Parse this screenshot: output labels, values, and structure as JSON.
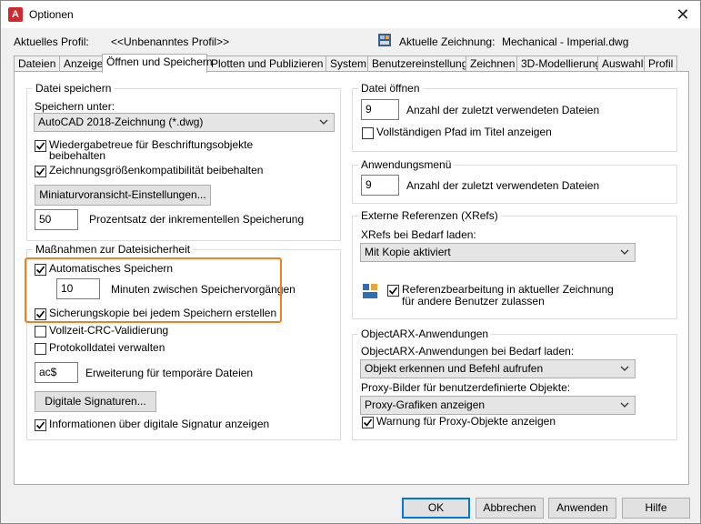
{
  "window": {
    "title": "Optionen",
    "app_icon_letter": "A"
  },
  "profile": {
    "label": "Aktuelles Profil:",
    "value": "<<Unbenanntes Profil>>",
    "drawing_label": "Aktuelle Zeichnung:",
    "drawing_value": "Mechanical - Imperial.dwg"
  },
  "tabs": [
    "Dateien",
    "Anzeige",
    "Öffnen und Speichern",
    "Plotten und Publizieren",
    "System",
    "Benutzereinstellungen",
    "Zeichnen",
    "3D-Modellierung",
    "Auswahl",
    "Profil"
  ],
  "active_tab": "Öffnen und Speichern",
  "save": {
    "title": "Datei speichern",
    "save_as_label": "Speichern unter:",
    "save_as_value": "AutoCAD 2018-Zeichnung (*.dwg)",
    "fidelity_line1": "Wiedergabetreue für Beschriftungsobjekte",
    "fidelity_line2": "beibehalten",
    "fidelity_checked": true,
    "size_compat": "Zeichnungsgrößenkompatibilität beibehalten",
    "size_compat_checked": true,
    "thumbnail_button": "Miniaturvoransicht-Einstellungen...",
    "incremental_value": "50",
    "incremental_label": "Prozentsatz der inkrementellen Speicherung"
  },
  "safety": {
    "title": "Maßnahmen zur Dateisicherheit",
    "autosave": "Automatisches Speichern",
    "autosave_checked": true,
    "minutes_value": "10",
    "minutes_label": "Minuten zwischen Speichervorgängen",
    "backup": "Sicherungskopie bei jedem Speichern erstellen",
    "backup_checked": true,
    "crc": "Vollzeit-CRC-Validierung",
    "crc_checked": false,
    "logfile": "Protokolldatei verwalten",
    "logfile_checked": false,
    "temp_ext_value": "ac$",
    "temp_ext_label": "Erweiterung für temporäre Dateien",
    "signatures_button": "Digitale Signaturen...",
    "sig_info": "Informationen über digitale Signatur anzeigen",
    "sig_info_checked": true
  },
  "open": {
    "title": "Datei öffnen",
    "recent_value": "9",
    "recent_label": "Anzahl der zuletzt verwendeten Dateien",
    "full_path": "Vollständigen Pfad im Titel anzeigen",
    "full_path_checked": false
  },
  "appmenu": {
    "title": "Anwendungsmenü",
    "recent_value": "9",
    "recent_label": "Anzahl der zuletzt verwendeten Dateien"
  },
  "xrefs": {
    "title": "Externe Referenzen (XRefs)",
    "demand_label": "XRefs bei Bedarf laden:",
    "demand_value": "Mit Kopie aktiviert",
    "edit_line1": "Referenzbearbeitung in aktueller Zeichnung",
    "edit_line2": "für andere Benutzer zulassen",
    "edit_checked": true
  },
  "arx": {
    "title": "ObjectARX-Anwendungen",
    "demand_label": "ObjectARX-Anwendungen bei Bedarf laden:",
    "demand_value": "Objekt erkennen und Befehl aufrufen",
    "proxy_label": "Proxy-Bilder für benutzerdefinierte Objekte:",
    "proxy_value": "Proxy-Grafiken anzeigen",
    "proxy_warn": "Warnung für Proxy-Objekte anzeigen",
    "proxy_warn_checked": true
  },
  "footer": {
    "ok": "OK",
    "cancel": "Abbrechen",
    "apply": "Anwenden",
    "help": "Hilfe"
  },
  "colors": {
    "highlight": "#f27f28",
    "app_icon": "#d4262e",
    "default_button_border": "#0078d7"
  }
}
